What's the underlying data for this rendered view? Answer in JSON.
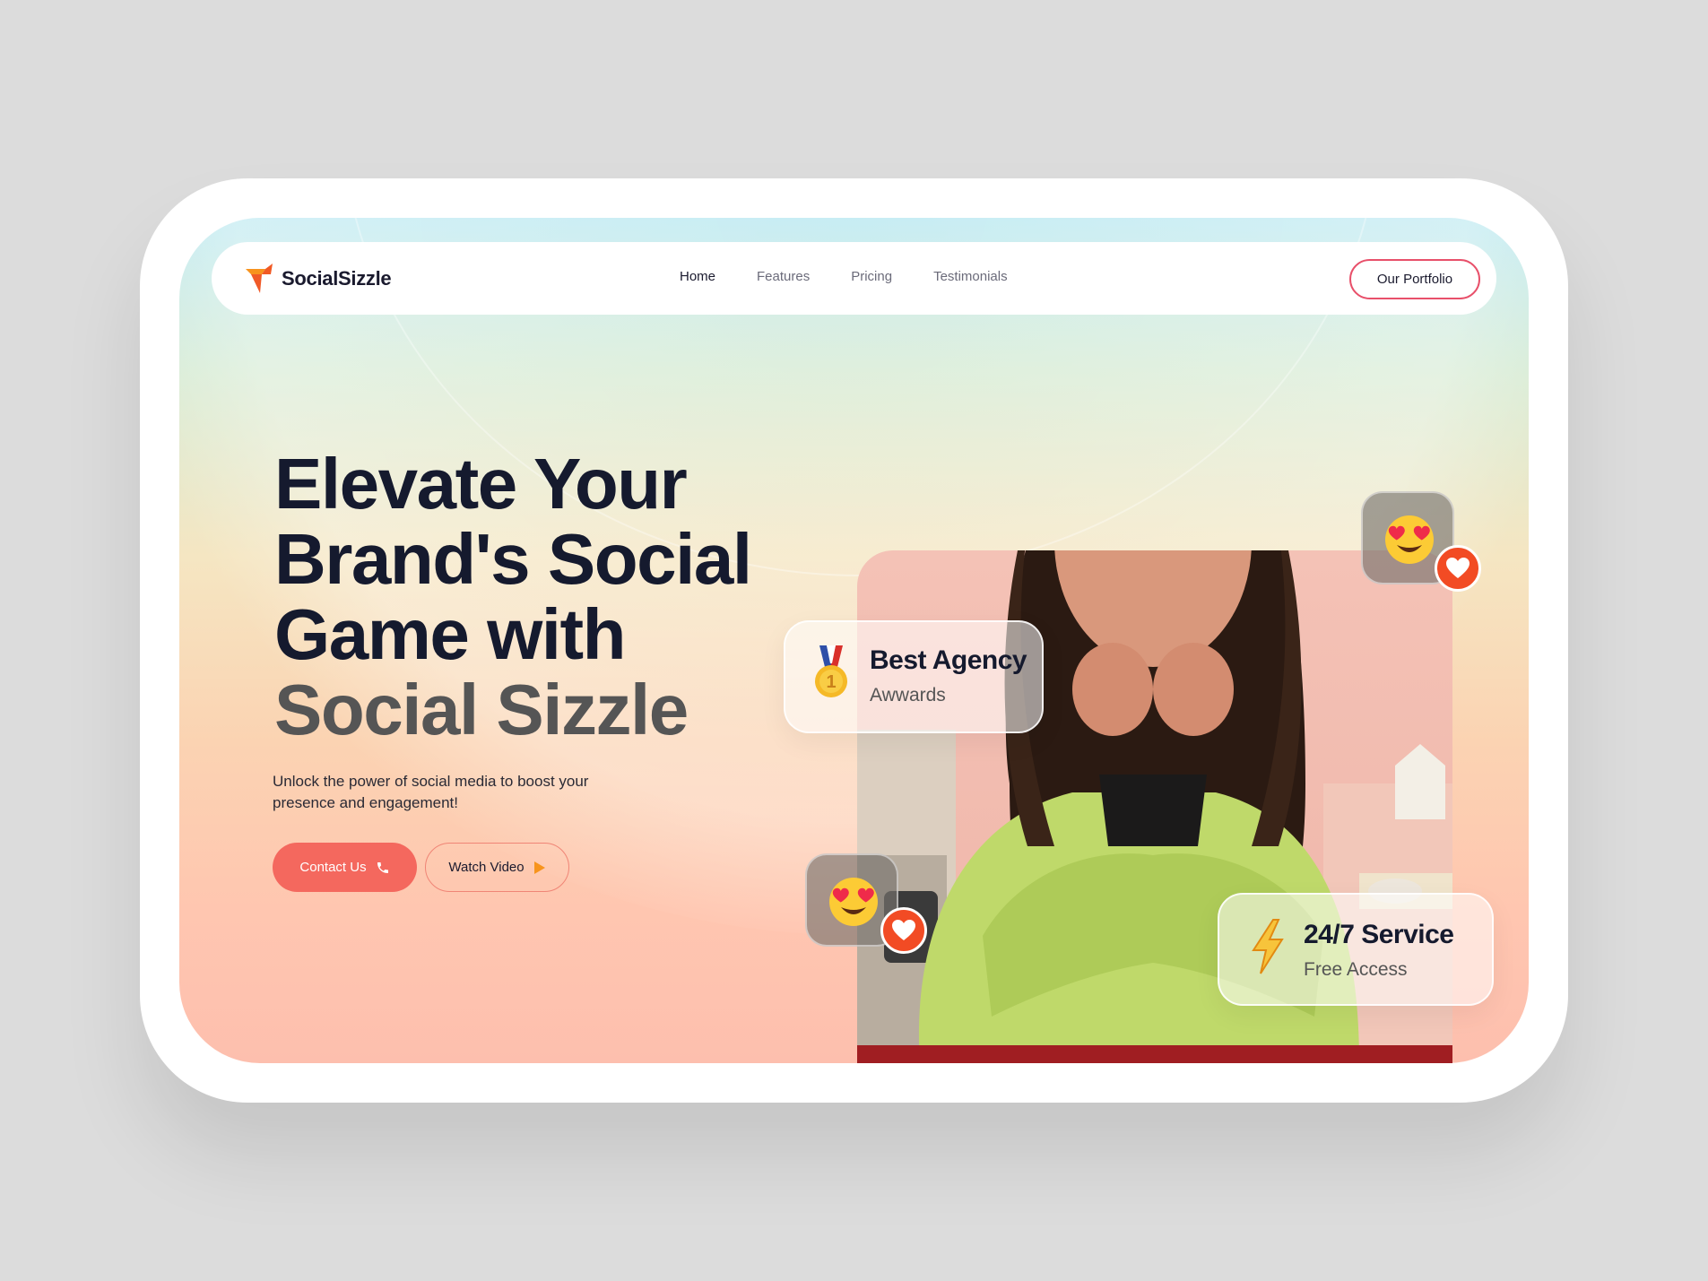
{
  "brand": {
    "name": "SocialSizzle"
  },
  "nav": {
    "links": [
      "Home",
      "Features",
      "Pricing",
      "Testimonials"
    ],
    "active": "Home",
    "portfolio_label": "Our Portfolio"
  },
  "hero": {
    "headline_lines": [
      "Elevate Your",
      "Brand's Social",
      "Game with"
    ],
    "headline_highlight": "Social Sizzle",
    "subtitle": "Unlock the power of social media to boost your presence and engagement!",
    "contact_label": "Contact Us",
    "watch_label": "Watch Video"
  },
  "badges": {
    "award": {
      "title": "Best Agency",
      "subtitle": "Awwards"
    },
    "service": {
      "title": "24/7 Service",
      "subtitle": "Free Access"
    }
  },
  "icons": {
    "logo": "arrow-logo-icon",
    "contact": "phone-icon",
    "watch": "play-icon",
    "award": "gold-medal-icon",
    "service": "lightning-icon",
    "reaction": "heart-eyes-emoji-icon",
    "like": "heart-icon"
  },
  "colors": {
    "accent": "#f4685e",
    "portfolio_border": "#e8506a",
    "heart_badge": "#f24b24",
    "headline": "#151a2e",
    "headline_muted": "#555555"
  }
}
